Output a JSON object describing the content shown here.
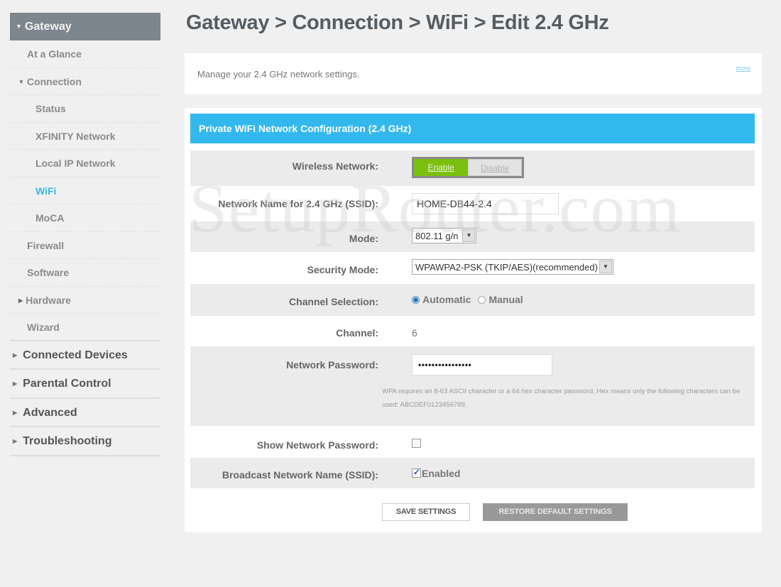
{
  "sidebar": {
    "gateway": "Gateway",
    "items": [
      {
        "label": "At a Glance"
      },
      {
        "label": "Connection"
      },
      {
        "label": "Status"
      },
      {
        "label": "XFINITY Network"
      },
      {
        "label": "Local IP Network"
      },
      {
        "label": "WiFi"
      },
      {
        "label": "MoCA"
      },
      {
        "label": "Firewall"
      },
      {
        "label": "Software"
      },
      {
        "label": "Hardware"
      },
      {
        "label": "Wizard"
      }
    ],
    "top_items": [
      {
        "label": "Connected Devices"
      },
      {
        "label": "Parental Control"
      },
      {
        "label": "Advanced"
      },
      {
        "label": "Troubleshooting"
      }
    ]
  },
  "header": {
    "title": "Gateway > Connection > WiFi > Edit 2.4 GHz"
  },
  "intro": {
    "text": "Manage your 2.4 GHz network settings.",
    "more_link": "more"
  },
  "panel": {
    "title": "Private WiFi Network Configuration (2.4 GHz)",
    "wireless_network": {
      "label": "Wireless Network:",
      "enable": "Enable",
      "disable": "Disable",
      "selected": "Enable"
    },
    "ssid": {
      "label": "Network Name for 2.4 GHz (SSID):",
      "value": "HOME-DB44-2.4"
    },
    "mode": {
      "label": "Mode:",
      "value": "802.11 g/n"
    },
    "security_mode": {
      "label": "Security Mode:",
      "value": "WPAWPA2-PSK (TKIP/AES)(recommended)"
    },
    "channel_selection": {
      "label": "Channel Selection:",
      "options": [
        "Automatic",
        "Manual"
      ],
      "selected": "Automatic"
    },
    "channel": {
      "label": "Channel:",
      "value": "6"
    },
    "password": {
      "label": "Network Password:",
      "masked_value": "••••••••••••••••",
      "hint": "WPA requires an 8-63 ASCII character or a 64 hex character password. Hex means only the following characters can be used: ABCDEF0123456789."
    },
    "show_password": {
      "label": "Show Network Password:",
      "checked": false
    },
    "broadcast_ssid": {
      "label": "Broadcast Network Name (SSID):",
      "checkbox_label": "Enabled",
      "checked": true
    },
    "buttons": {
      "save": "SAVE SETTINGS",
      "restore": "RESTORE DEFAULT SETTINGS"
    }
  },
  "watermark": "SetupRouter.com",
  "colors": {
    "accent_blue": "#33b8ee",
    "enable_green": "#7bc00e",
    "sidebar_header": "#7d868c",
    "active_link": "#39b6e8"
  }
}
